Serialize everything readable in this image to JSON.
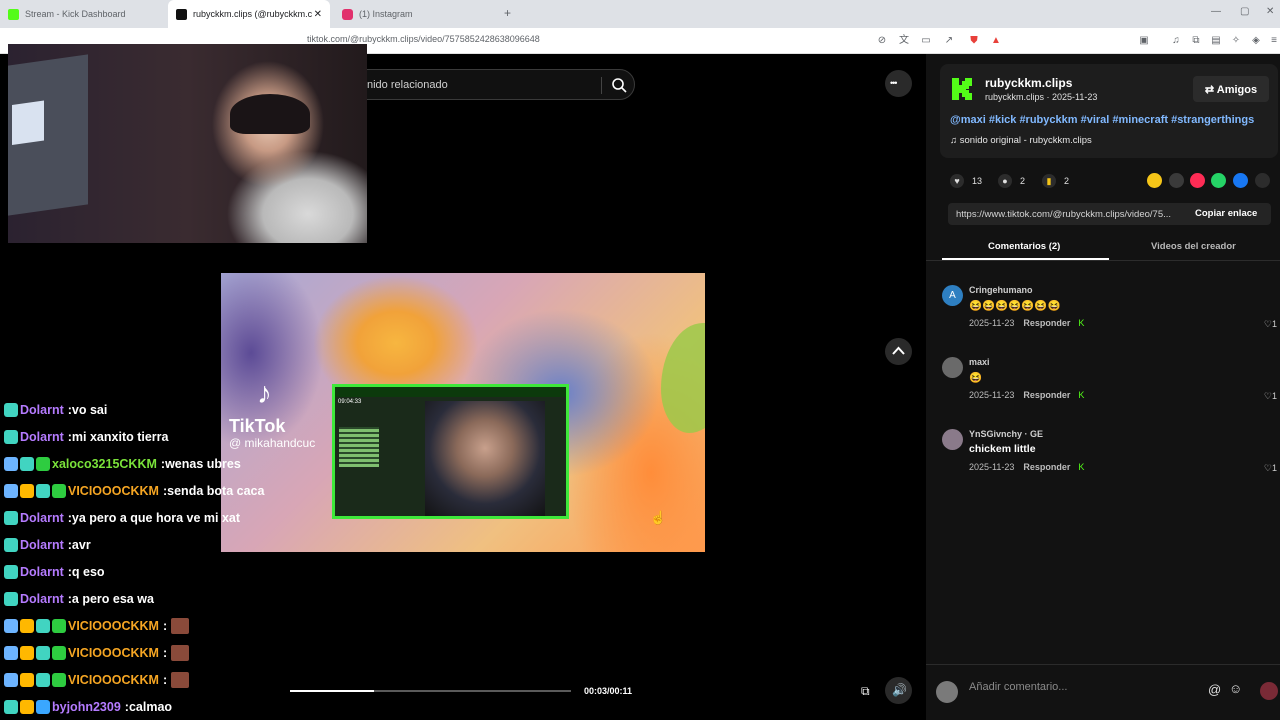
{
  "tabs": [
    {
      "title": "Stream - Kick Dashboard",
      "color": "#53fc18"
    },
    {
      "title": "rubyckkm.clips (@rubyckkm.c",
      "color": "#111111"
    },
    {
      "title": "(1) Instagram",
      "color": "#e1306c"
    }
  ],
  "new_tab": "+",
  "window": {
    "minimize": "—",
    "maximize": "▢",
    "close": "✕"
  },
  "address": {
    "url": "tiktok.com/@rubyckkm.clips/video/7575852428638096648"
  },
  "search": {
    "placeholder": "nido relacionado"
  },
  "more_label": "•••",
  "video": {
    "tiktok_logo": "♪",
    "tiktok_brand": "TikTok",
    "tiktok_handle": "@ mikahandcuc",
    "inner_time": "09:04:33",
    "progress_fraction": 0.3,
    "timecode": "00:03/00:11"
  },
  "chat": [
    {
      "user": "Dolarnt",
      "text": "vo sai",
      "color": "#b57bff",
      "badges": [
        "#41d4c1"
      ]
    },
    {
      "user": "Dolarnt",
      "text": "mi xanxito tierra",
      "color": "#b57bff",
      "badges": [
        "#41d4c1"
      ]
    },
    {
      "user": "xaloco3215CKKM",
      "text": "wenas ubres",
      "color": "#7ae23a",
      "badges": [
        "#6db4ff",
        "#41d4c1",
        "#2ecc40"
      ]
    },
    {
      "user": "VICIOOOCKKM",
      "text": "senda bota caca",
      "color": "#f6a623",
      "badges": [
        "#6db4ff",
        "#ffb800",
        "#41d4c1",
        "#2ecc40"
      ]
    },
    {
      "user": "Dolarnt",
      "text": "ya pero a que hora ve mi xat",
      "color": "#b57bff",
      "badges": [
        "#41d4c1"
      ]
    },
    {
      "user": "Dolarnt",
      "text": "avr",
      "color": "#b57bff",
      "badges": [
        "#41d4c1"
      ]
    },
    {
      "user": "Dolarnt",
      "text": "q eso",
      "color": "#b57bff",
      "badges": [
        "#41d4c1"
      ]
    },
    {
      "user": "Dolarnt",
      "text": "a pero esa wa",
      "color": "#b57bff",
      "badges": [
        "#41d4c1"
      ]
    },
    {
      "user": "VICIOOOCKKM",
      "text": "",
      "color": "#f6a623",
      "badges": [
        "#6db4ff",
        "#ffb800",
        "#41d4c1",
        "#2ecc40"
      ],
      "emote": true
    },
    {
      "user": "VICIOOOCKKM",
      "text": "",
      "color": "#f6a623",
      "badges": [
        "#6db4ff",
        "#ffb800",
        "#41d4c1",
        "#2ecc40"
      ],
      "emote": true
    },
    {
      "user": "VICIOOOCKKM",
      "text": "",
      "color": "#f6a623",
      "badges": [
        "#6db4ff",
        "#ffb800",
        "#41d4c1",
        "#2ecc40"
      ],
      "emote": true
    },
    {
      "user": "byjohn2309",
      "text": "calmao",
      "color": "#b57bff",
      "badges": [
        "#41d4c1",
        "#ffb800",
        "#3aa7ff"
      ]
    }
  ],
  "author": {
    "name": "rubyckkm.clips",
    "sub": "rubyckkm.clips · 2025-11-23",
    "friends_button": "⇄ Amigos",
    "hashtags": "@maxi #kick #rubyckkm #viral #minecraft #strangerthings",
    "sound": "♫ sonido original - rubyckkm.clips"
  },
  "stats": {
    "likes": "13",
    "comments": "2",
    "saves": "2"
  },
  "share_colors": [
    "#f5c518",
    "#3a3a3a",
    "#fe2c55",
    "#25d366",
    "#1877f2",
    "#2c2c2c"
  ],
  "link": {
    "url": "https://www.tiktok.com/@rubyckkm.clips/video/75...",
    "copy_label": "Copiar enlace"
  },
  "panel_tabs": {
    "comments": "Comentarios (2)",
    "creator_videos": "Videos del creador"
  },
  "comments": [
    {
      "user": "Cringehumano",
      "text": "😆😆😆😆😆😆😆",
      "date": "2025-11-23",
      "reply": "Responder",
      "likes": "1",
      "avatar_color": "#2e7fc1",
      "avatar_letter": "A"
    },
    {
      "user": "maxi",
      "text": "😆",
      "date": "2025-11-23",
      "reply": "Responder",
      "likes": "1",
      "avatar_color": "#6a6a6a",
      "avatar_letter": ""
    },
    {
      "user": "YnSGivnchy · GE",
      "text": "chickem little",
      "date": "2025-11-23",
      "reply": "Responder",
      "likes": "1",
      "avatar_color": "#8a7a8a",
      "avatar_letter": ""
    }
  ],
  "comment_input": {
    "placeholder": "Añadir comentario..."
  }
}
